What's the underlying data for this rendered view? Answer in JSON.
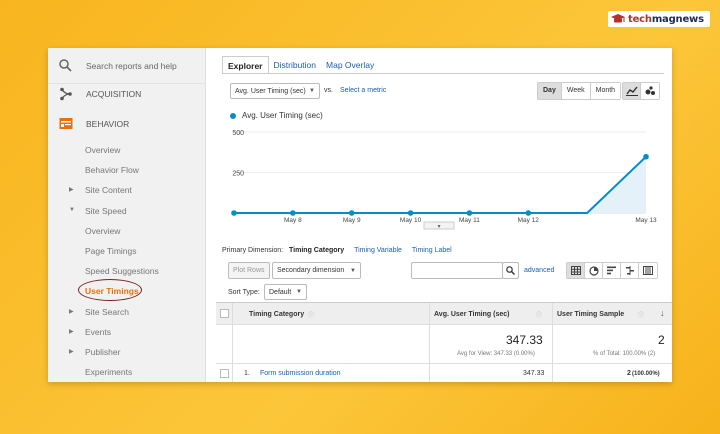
{
  "brand": {
    "logo_text_1": "tech",
    "logo_text_2": "magnews"
  },
  "sidebar": {
    "search_placeholder": "Search reports and help",
    "acquisition": "ACQUISITION",
    "behavior": "BEHAVIOR",
    "items": [
      {
        "label": "Overview",
        "indent": 1
      },
      {
        "label": "Behavior Flow",
        "indent": 1
      },
      {
        "label": "Site Content",
        "indent": 1,
        "arrow": "▶"
      },
      {
        "label": "Site Speed",
        "indent": 1,
        "arrow": "▼"
      },
      {
        "label": "Overview",
        "indent": 2
      },
      {
        "label": "Page Timings",
        "indent": 2
      },
      {
        "label": "Speed Suggestions",
        "indent": 2
      },
      {
        "label": "User Timings",
        "indent": 2,
        "active": true
      },
      {
        "label": "Site Search",
        "indent": 1,
        "arrow": "▶"
      },
      {
        "label": "Events",
        "indent": 1,
        "arrow": "▶"
      },
      {
        "label": "Publisher",
        "indent": 1,
        "arrow": "▶"
      },
      {
        "label": "Experiments",
        "indent": 1
      }
    ]
  },
  "tabs": [
    "Explorer",
    "Distribution",
    "Map Overlay"
  ],
  "controls": {
    "metric_select": "Avg. User Timing (sec)",
    "vs": "vs.",
    "select_metric": "Select a metric",
    "range_buttons": [
      "Day",
      "Week",
      "Month"
    ]
  },
  "chart_data": {
    "type": "line",
    "series": [
      {
        "name": "Avg. User Timing (sec)",
        "values": [
          0,
          0,
          0,
          0,
          0,
          0,
          0,
          347.33
        ]
      }
    ],
    "x": [
      "",
      "May 8",
      "May 9",
      "May 10",
      "May 11",
      "May 12",
      "",
      "May 13"
    ],
    "yticks": [
      "500",
      "250"
    ],
    "ylim": [
      0,
      500
    ],
    "color": "#058dc7",
    "fill": "#e4f1f9"
  },
  "primary_dimension": {
    "label": "Primary Dimension:",
    "current": "Timing Category",
    "options": [
      "Timing Variable",
      "Timing Label"
    ]
  },
  "toolbar": {
    "plot_rows": "Plot Rows",
    "secondary": "Secondary dimension",
    "advanced": "advanced",
    "sort_label": "Sort Type:",
    "sort_value": "Default"
  },
  "table": {
    "headers": [
      "Timing Category",
      "Avg. User Timing (sec)",
      "User Timing Sample"
    ],
    "total_avg": "347.33",
    "total_avg_sub": "Avg for View: 347.33 (0.00%)",
    "total_sample": "2",
    "total_sample_sub": "% of Total: 100.00% (2)",
    "rows": [
      {
        "index": "1.",
        "category": "Form submission duration",
        "avg": "347.33",
        "sample": "2",
        "sample_pct": "(100.00%)"
      }
    ]
  }
}
